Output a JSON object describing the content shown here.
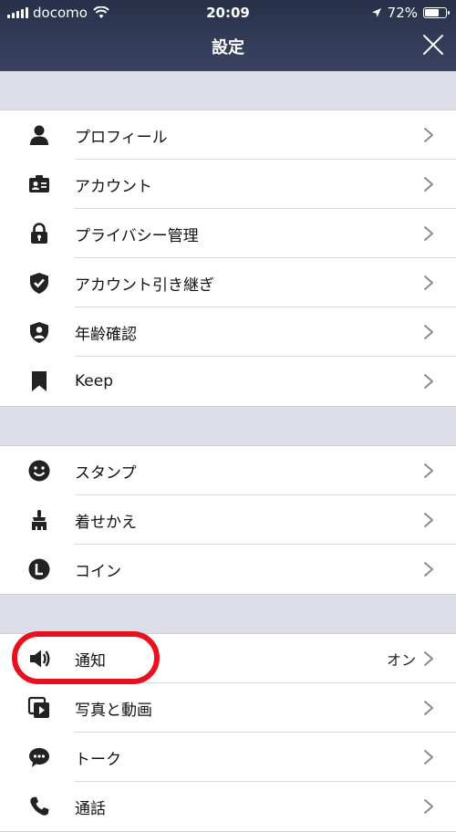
{
  "status": {
    "carrier": "docomo",
    "time": "20:09",
    "battery": "72%",
    "battery_level": 0.72
  },
  "header": {
    "title": "設定"
  },
  "groups": [
    {
      "items": [
        {
          "label": "プロフィール",
          "icon": "person-icon"
        },
        {
          "label": "アカウント",
          "icon": "id-card-icon"
        },
        {
          "label": "プライバシー管理",
          "icon": "lock-icon"
        },
        {
          "label": "アカウント引き継ぎ",
          "icon": "shield-check-icon"
        },
        {
          "label": "年齢確認",
          "icon": "shield-person-icon"
        },
        {
          "label": "Keep",
          "icon": "bookmark-icon"
        }
      ]
    },
    {
      "items": [
        {
          "label": "スタンプ",
          "icon": "smiley-icon"
        },
        {
          "label": "着せかえ",
          "icon": "brush-icon"
        },
        {
          "label": "コイン",
          "icon": "coin-icon"
        }
      ]
    },
    {
      "items": [
        {
          "label": "通知",
          "value": "オン",
          "icon": "speaker-icon"
        },
        {
          "label": "写真と動画",
          "icon": "media-icon"
        },
        {
          "label": "トーク",
          "icon": "chat-bubble-icon"
        },
        {
          "label": "通話",
          "icon": "phone-icon"
        }
      ]
    }
  ],
  "colors": {
    "header": "#2d3650",
    "section_bg": "#dcdde6",
    "highlight": "#e8101c"
  }
}
